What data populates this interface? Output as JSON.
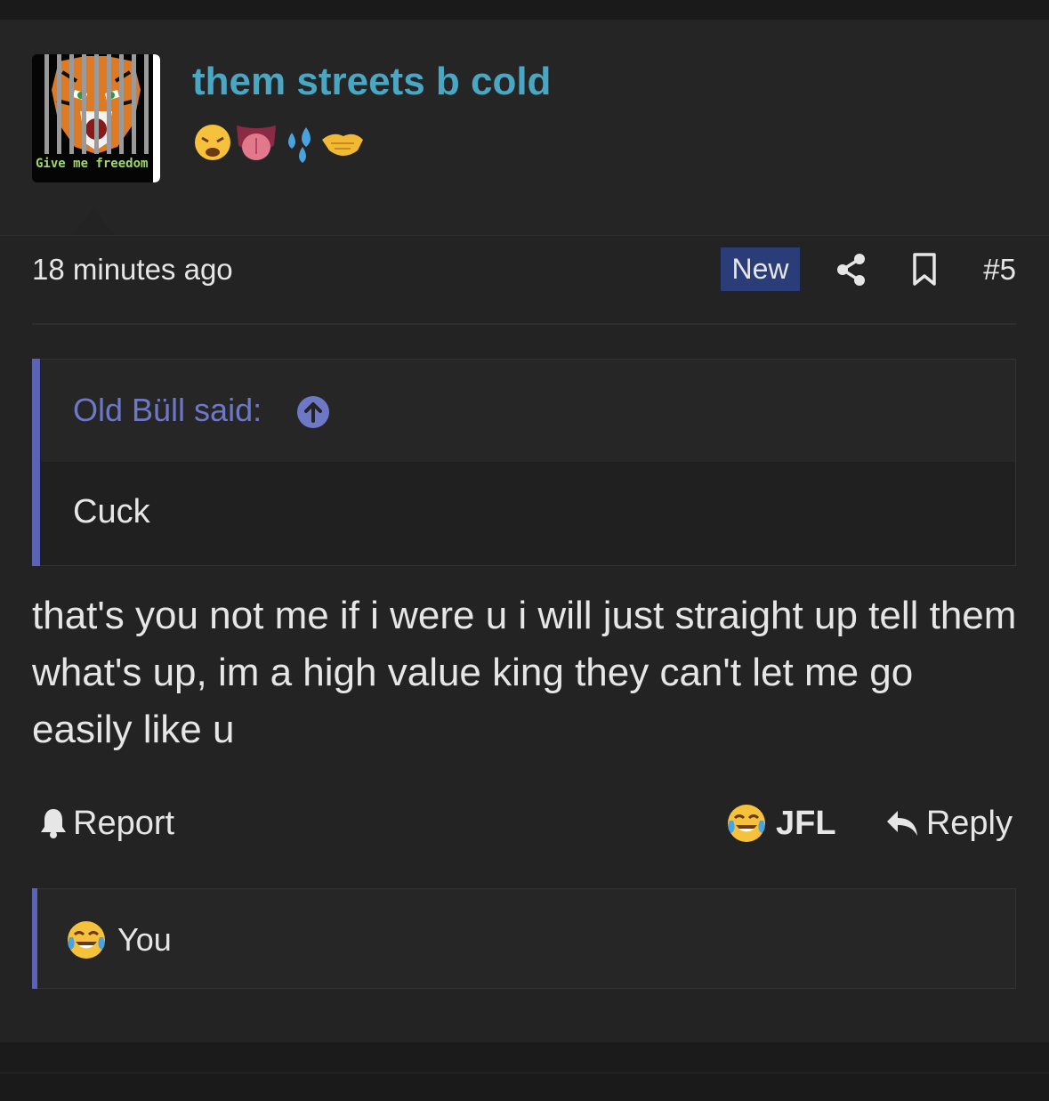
{
  "post": {
    "author": {
      "username": "them streets b cold",
      "avatar_caption": "Give me freedom",
      "avatar_icon": "caged-tiger-avatar",
      "emoji_icons": [
        "weary-face-emoji",
        "tongue-emoji",
        "sweat-droplets-emoji",
        "handshake-emoji"
      ]
    },
    "time": "18 minutes ago",
    "new_label": "New",
    "post_number": "#5",
    "quote": {
      "author_line": "Old Büll said:",
      "text": "Cuck"
    },
    "message": "that's you not me if i were u i will just straight up tell them what's up, im a high value king they can't let me go easily like u",
    "actions": {
      "report_label": "Report",
      "reaction_label": "JFL",
      "reply_label": "Reply"
    },
    "reactions_summary": {
      "label": "You",
      "icon": "tears-of-joy-emoji"
    }
  },
  "colors": {
    "username": "#49a7c4",
    "accent": "#5b63b4",
    "new_badge": "#2a3d78"
  }
}
